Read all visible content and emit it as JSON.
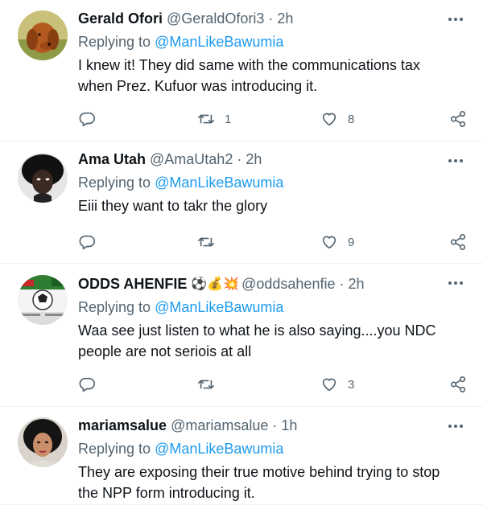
{
  "tweets": [
    {
      "name": "Gerald Ofori",
      "handle": "@GeraldOfori3",
      "time": "2h",
      "replying_prefix": "Replying to ",
      "replying_to": "@ManLikeBawumia",
      "text_lines": [
        "I knew it! They did same with the communications tax",
        "when Prez. Kufuor was introducing it."
      ],
      "retweets": "1",
      "likes": "8",
      "avatar_icon": "dog-avatar"
    },
    {
      "name": "Ama Utah",
      "handle": "@AmaUtah2",
      "time": "2h",
      "replying_prefix": "Replying to ",
      "replying_to": "@ManLikeBawumia",
      "text_lines": [
        "Eiii they want to takr the glory"
      ],
      "retweets": "",
      "likes": "9",
      "avatar_icon": "person-avatar"
    },
    {
      "name": "ODDS AHENFIE",
      "name_emojis": "⚽💰💥",
      "handle": "@oddsahenfie",
      "time": "2h",
      "replying_prefix": "Replying to ",
      "replying_to": "@ManLikeBawumia",
      "text_lines": [
        "Waa see just listen to what he is also saying....you NDC",
        "people are not seriois at all"
      ],
      "retweets": "",
      "likes": "3",
      "avatar_icon": "sports-betting-avatar"
    },
    {
      "name": "mariamsalue",
      "handle": "@mariamsalue",
      "time": "1h",
      "replying_prefix": "Replying to ",
      "replying_to": "@ManLikeBawumia",
      "text_lines": [
        "They are exposing their true motive behind trying to stop",
        "the NPP form introducing it."
      ],
      "avatar_icon": "woman-avatar"
    }
  ],
  "colors": {
    "accent": "#1d9bf0",
    "secondary_text": "#536471",
    "divider": "#eff3f4"
  }
}
